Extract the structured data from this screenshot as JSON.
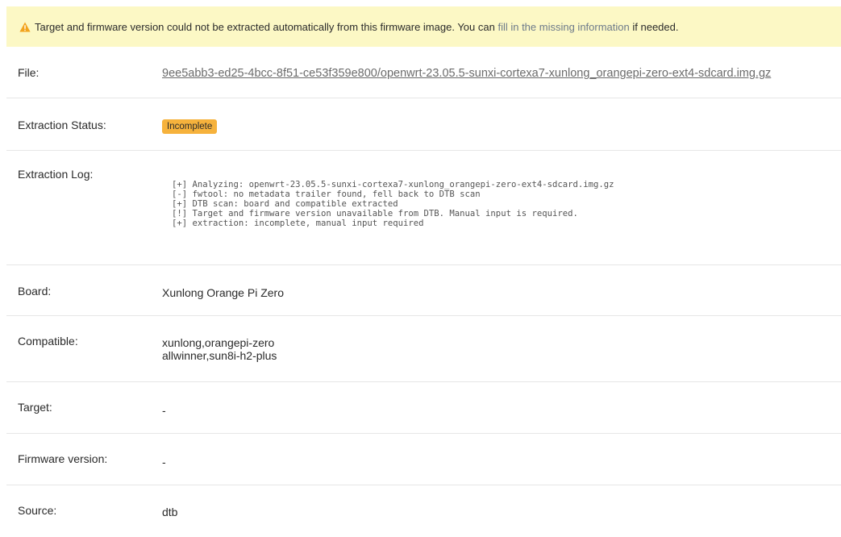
{
  "alert": {
    "icon": "warning-triangle-icon",
    "text_before": "Target and firmware version could not be extracted automatically from this firmware image. You can",
    "link_text": "fill in the missing information",
    "text_after": "if needed."
  },
  "details": {
    "file": {
      "label": "File:",
      "value": "9ee5abb3-ed25-4bcc-8f51-ce53f359e800/openwrt-23.05.5-sunxi-cortexa7-xunlong_orangepi-zero-ext4-sdcard.img.gz"
    },
    "status": {
      "label": "Extraction Status:",
      "value": "Incomplete",
      "color": "#f6b23c"
    },
    "log": {
      "label": "Extraction Log:",
      "lines": [
        "[+] Analyzing: openwrt-23.05.5-sunxi-cortexa7-xunlong_orangepi-zero-ext4-sdcard.img.gz",
        "[-] fwtool: no metadata trailer found, fell back to DTB scan",
        "[+] DTB scan: board and compatible extracted",
        "[!] Target and firmware version unavailable from DTB. Manual input is required.",
        "[+] extraction: incomplete, manual input required"
      ]
    },
    "board": {
      "label": "Board:",
      "value": "Xunlong Orange Pi Zero"
    },
    "compatible": {
      "label": "Compatible:",
      "values": [
        "xunlong,orangepi-zero",
        "allwinner,sun8i-h2-plus"
      ]
    },
    "target": {
      "label": "Target:",
      "value": "-"
    },
    "firmware_version": {
      "label": "Firmware version:",
      "value": "-"
    },
    "source": {
      "label": "Source:",
      "value": "dtb"
    }
  }
}
